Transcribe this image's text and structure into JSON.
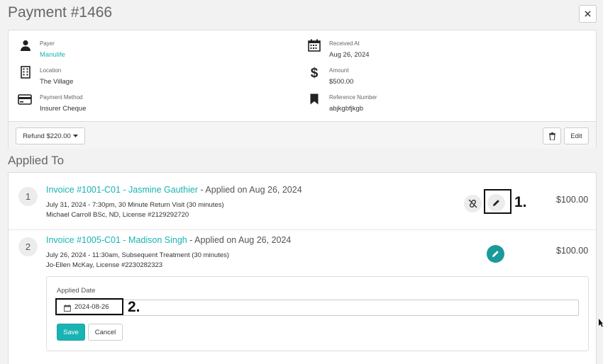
{
  "header": {
    "title": "Payment #1466",
    "close_icon": "close-icon"
  },
  "payment_info": {
    "payer": {
      "label": "Payer",
      "value": "Manulife",
      "icon": "user-icon"
    },
    "location": {
      "label": "Location",
      "value": "The Village",
      "icon": "building-icon"
    },
    "payment_method": {
      "label": "Payment Method",
      "value": "Insurer Cheque",
      "icon": "credit-card-icon"
    },
    "received_at": {
      "label": "Received At",
      "value": "Aug 26, 2024",
      "icon": "calendar-icon"
    },
    "amount": {
      "label": "Amount",
      "value": "$500.00",
      "icon": "dollar-icon"
    },
    "reference_number": {
      "label": "Reference Number",
      "value": "abjkgbfjkgb",
      "icon": "bookmark-icon"
    }
  },
  "actions": {
    "refund_label": "Refund $220.00",
    "edit_label": "Edit",
    "delete_icon": "trash-icon"
  },
  "applied_to": {
    "title": "Applied To",
    "items": [
      {
        "number": "1",
        "invoice": "Invoice #1001-C01 - Jasmine Gauthier",
        "applied_on": " - Applied on Aug 26, 2024",
        "detail1": "July 31, 2024 - 7:30pm, 30 Minute Return Visit (30 minutes)",
        "detail2": "Michael Carroll BSc, ND, License #2129292720",
        "amount": "$100.00",
        "callout": "1."
      },
      {
        "number": "2",
        "invoice": "Invoice #1005-C01 - Madison Singh",
        "applied_on": " - Applied on Aug 26, 2024",
        "detail1": "July 26, 2024 - 11:30am, Subsequent Treatment (30 minutes)",
        "detail2": "Jo-Ellen McKay, License #2230282323",
        "amount": "$100.00"
      }
    ],
    "edit_form": {
      "label": "Applied Date",
      "date_value": "2024-08-26",
      "callout": "2.",
      "save_label": "Save",
      "cancel_label": "Cancel"
    }
  },
  "colors": {
    "accent": "#1ab3b3",
    "page_bg": "#f2f2f2"
  }
}
